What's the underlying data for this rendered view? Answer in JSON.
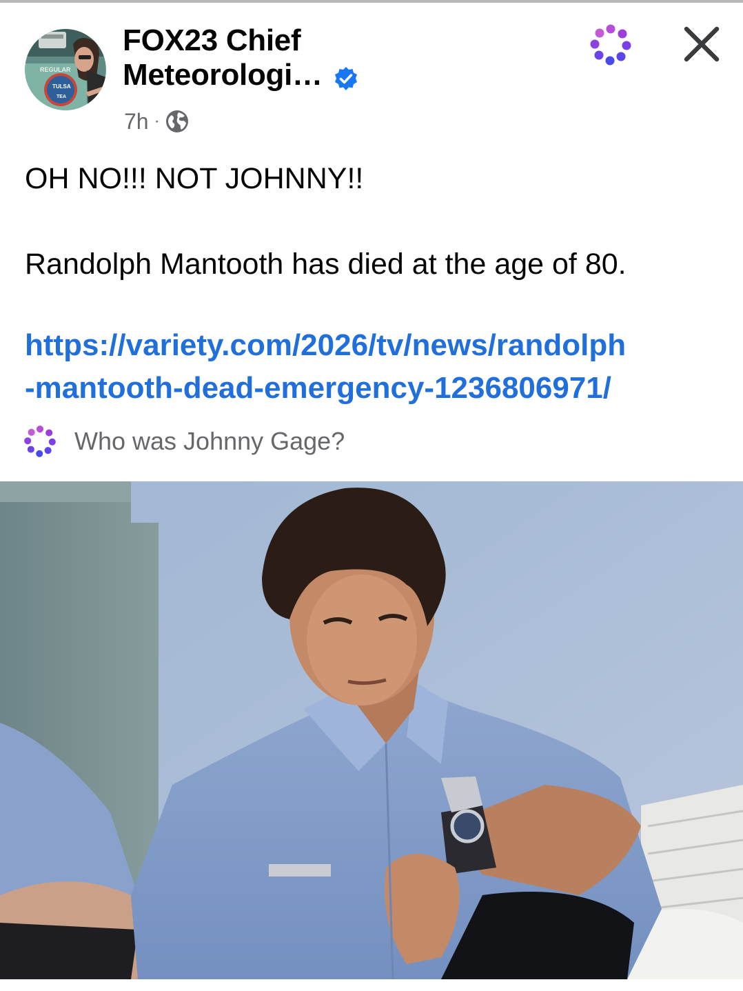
{
  "post": {
    "author_name_line1": "FOX23 Chief",
    "author_name_line2": "Meteorologi…",
    "timestamp": "7h",
    "separator": "·",
    "text_line1": "OH NO!!!  NOT JOHNNY!!",
    "text_line2": "Randolph Mantooth has died at the age of 80.",
    "link_line1": "https://variety.com/2026/tv/news/randolph",
    "link_line2": "-mantooth-dead-emergency-1236806971/"
  },
  "meta_ai": {
    "prompt": "Who was Johnny Gage?"
  },
  "avatar": {
    "sign_text_1": "REGULAR",
    "sign_text_2": "TULSA",
    "sign_text_3": "TEA"
  },
  "icons": {
    "verified": "verified-badge-icon",
    "audience": "globe-icon",
    "meta_ai": "meta-ai-icon",
    "close": "close-icon"
  },
  "colors": {
    "link": "#216fdb",
    "verified": "#1877f2",
    "secondary_text": "#65676b",
    "meta_ai_purple": "#7b3fe4"
  }
}
